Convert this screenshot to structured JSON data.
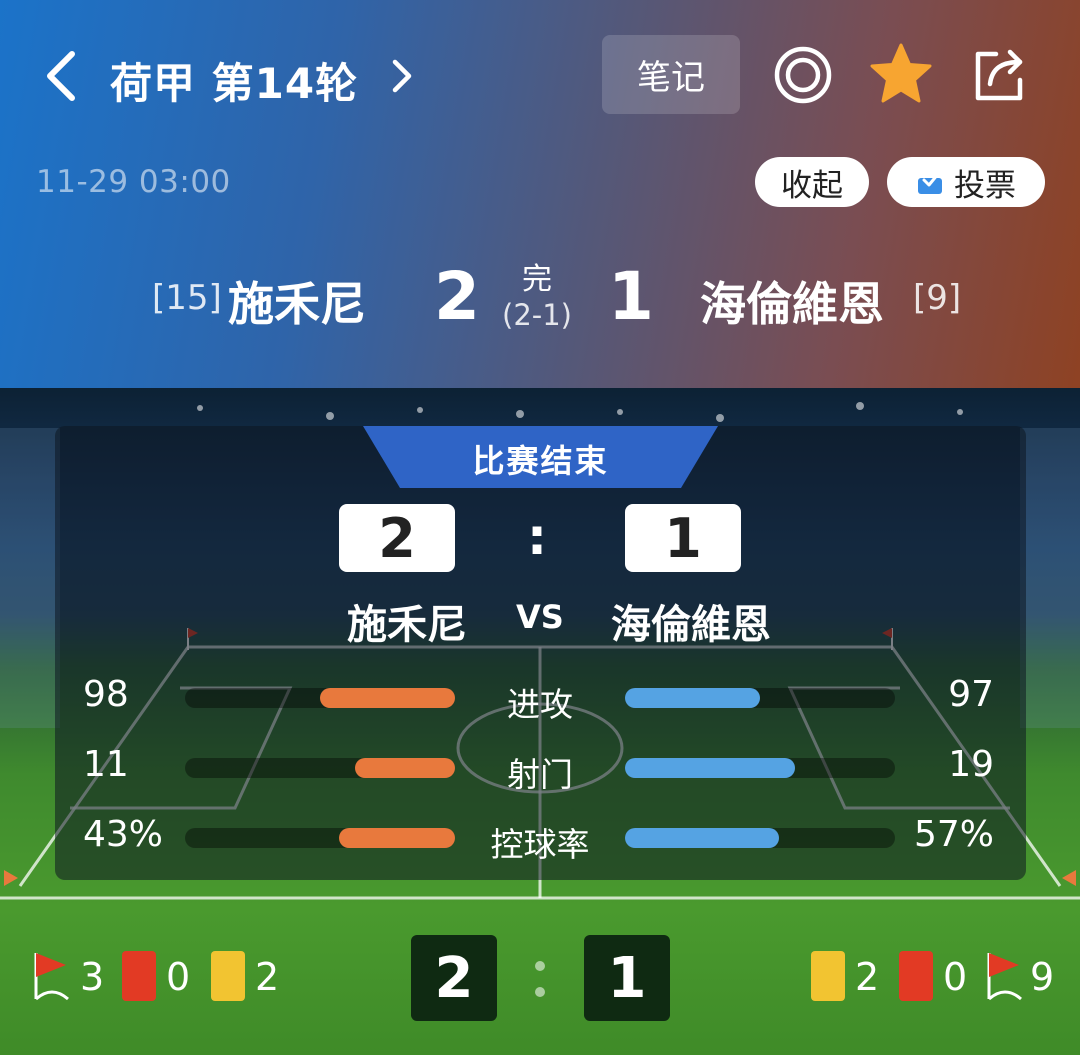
{
  "nav": {
    "round_title": "荷甲 第14轮",
    "note_label": "笔记"
  },
  "match": {
    "datetime": "11-29 03:00",
    "collapse_label": "收起",
    "vote_label": "投票",
    "home": {
      "rank": "[15]",
      "name": "施禾尼",
      "score": "2"
    },
    "away": {
      "rank": "[9]",
      "name": "海倫維恩",
      "score": "1"
    },
    "status": "完",
    "halftime": "(2-1)"
  },
  "panel": {
    "banner": "比赛结束",
    "home_score": "2",
    "away_score": "1",
    "colon": ":",
    "home_name": "施禾尼",
    "vs": "VS",
    "away_name": "海倫維恩",
    "stats": [
      {
        "label": "进攻",
        "home": "98",
        "away": "97",
        "home_ratio": 0.5,
        "away_ratio": 0.5
      },
      {
        "label": "射门",
        "home": "11",
        "away": "19",
        "home_ratio": 0.37,
        "away_ratio": 0.63
      },
      {
        "label": "控球率",
        "home": "43%",
        "away": "57%",
        "home_ratio": 0.43,
        "away_ratio": 0.57
      }
    ]
  },
  "bottom": {
    "home_corners": "3",
    "home_red": "0",
    "home_yellow": "2",
    "home_score": "2",
    "away_score": "1",
    "away_yellow": "2",
    "away_red": "0",
    "away_corners": "9"
  },
  "colors": {
    "home_bar": "#e8793d",
    "away_bar": "#55a3e3",
    "star": "#f7a531",
    "banner": "#2f64c6"
  }
}
